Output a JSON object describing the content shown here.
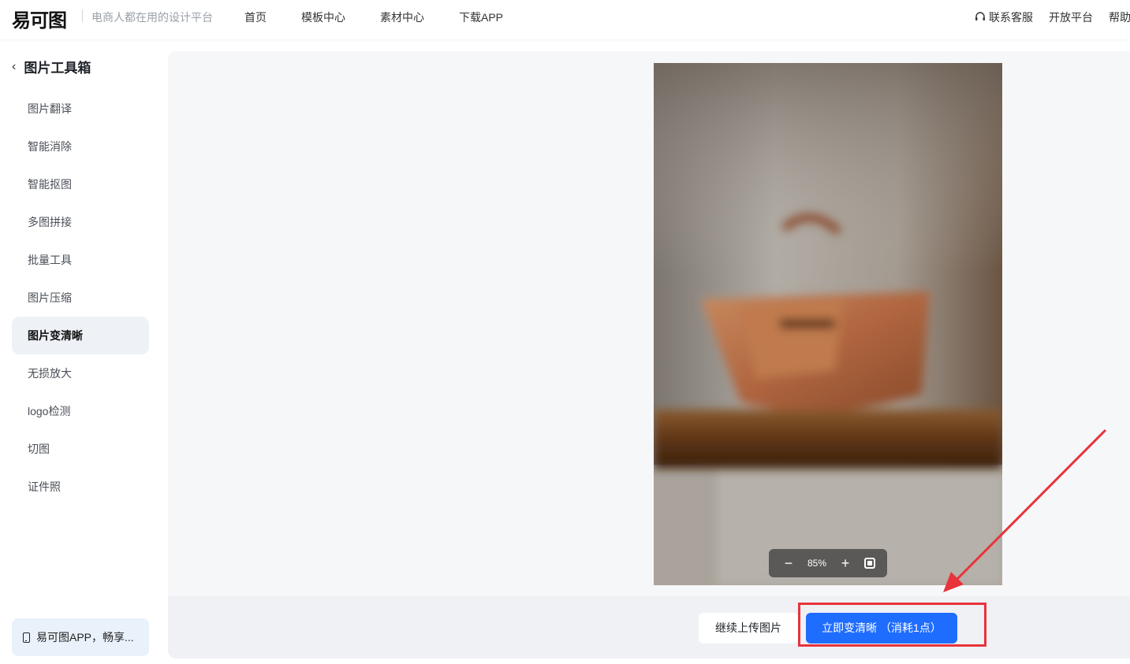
{
  "header": {
    "logo_text": "易可图",
    "slogan": "电商人都在用的设计平台",
    "nav": [
      "首页",
      "模板中心",
      "素材中心",
      "下载APP"
    ],
    "right_items": [
      "联系客服",
      "开放平台",
      "帮助"
    ]
  },
  "sidebar": {
    "title": "图片工具箱",
    "back_icon": "chevron-left-icon",
    "items": [
      {
        "label": "图片翻译"
      },
      {
        "label": "智能消除"
      },
      {
        "label": "智能抠图"
      },
      {
        "label": "多图拼接"
      },
      {
        "label": "批量工具"
      },
      {
        "label": "图片压缩"
      },
      {
        "label": "图片变清晰",
        "active": true
      },
      {
        "label": "无损放大"
      },
      {
        "label": "logo检测"
      },
      {
        "label": "切图"
      },
      {
        "label": "证件照"
      }
    ],
    "app_promo": "易可图APP，畅享..."
  },
  "preview": {
    "zoom_level": "85%",
    "zoom_out": "−",
    "zoom_in": "+"
  },
  "actions": {
    "upload_label": "继续上传图片",
    "enhance_label": "立即变清晰 （消耗1点）"
  },
  "colors": {
    "accent": "#1f6dff",
    "annotation": "#e8333a",
    "active_item_bg": "#eef1f6"
  }
}
